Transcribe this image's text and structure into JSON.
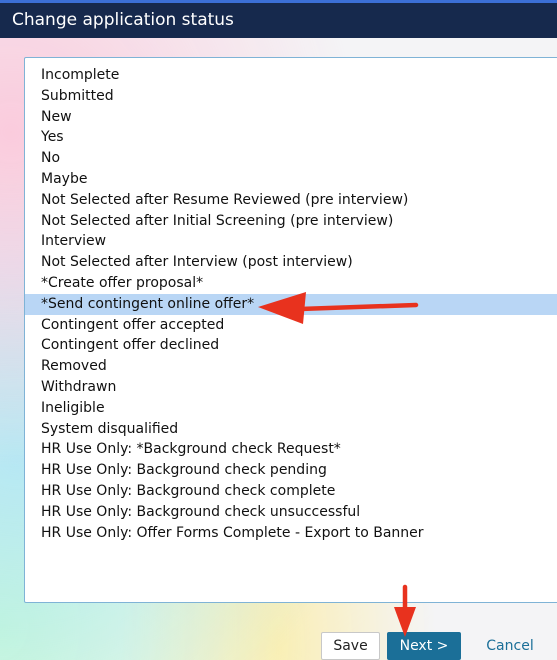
{
  "dialog": {
    "title": "Change application status"
  },
  "statuses": [
    "Incomplete",
    "Submitted",
    "New",
    "Yes",
    "No",
    "Maybe",
    "Not Selected after Resume Reviewed (pre interview)",
    "Not Selected after Initial Screening (pre interview)",
    "Interview",
    "Not Selected after Interview (post interview)",
    "*Create offer proposal*",
    "*Send contingent online offer*",
    "Contingent offer accepted",
    "Contingent offer declined",
    "Removed",
    "Withdrawn",
    "Ineligible",
    "System disqualified",
    "HR Use Only: *Background check Request*",
    "HR Use Only: Background check pending",
    "HR Use Only: Background check complete",
    "HR Use Only: Background check unsuccessful",
    "HR Use Only: Offer Forms Complete - Export to Banner"
  ],
  "selected_status": "*Send contingent online offer*",
  "buttons": {
    "save": "Save",
    "next": "Next >",
    "cancel": "Cancel"
  },
  "colors": {
    "title_bar": "#16294d",
    "selection": "#b9d6f5",
    "primary_button": "#1b6f98",
    "annotation_arrow": "#e8321e"
  }
}
